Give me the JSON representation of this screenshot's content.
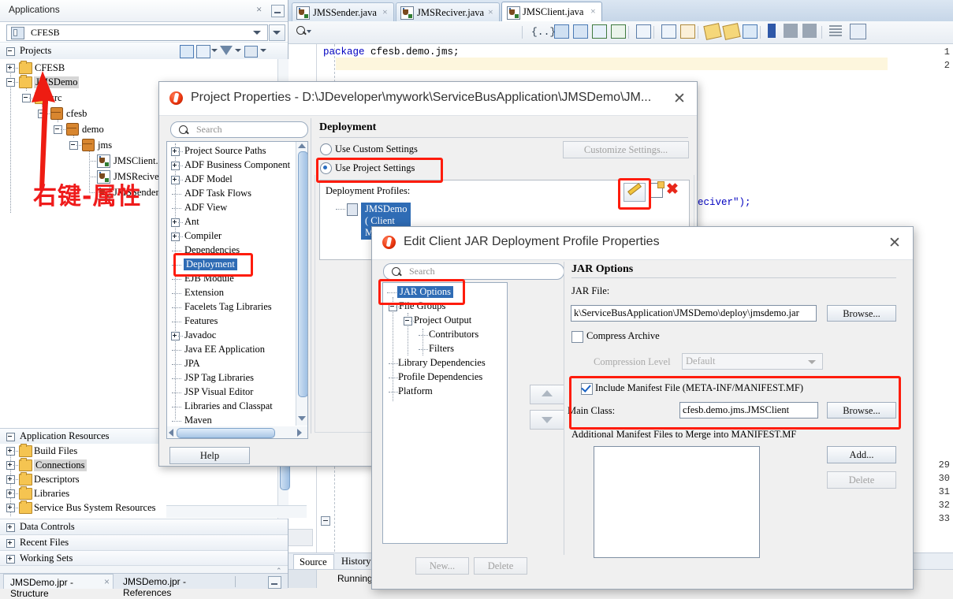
{
  "app": {
    "applications_panel_title": "Applications",
    "application_combo_value": "CFESB",
    "projects_header": "Projects",
    "application_resources_header": "Application Resources",
    "project_tree": [
      {
        "label": "CFESB",
        "type": "folder",
        "indent": 0,
        "expander": "plus",
        "selected": false
      },
      {
        "label": "JMSDemo",
        "type": "folder",
        "indent": 0,
        "expander": "minus",
        "selected": true
      },
      {
        "label": "src",
        "type": "folder",
        "indent": 1,
        "expander": "minus",
        "selected": false
      },
      {
        "label": "cfesb",
        "type": "package",
        "indent": 2,
        "expander": "minus",
        "selected": false
      },
      {
        "label": "demo",
        "type": "package",
        "indent": 3,
        "expander": "minus",
        "selected": false
      },
      {
        "label": "jms",
        "type": "package",
        "indent": 4,
        "expander": "minus",
        "selected": false
      },
      {
        "label": "JMSClient.",
        "type": "java",
        "indent": 5,
        "expander": "none",
        "selected": false
      },
      {
        "label": "JMSReciver.",
        "type": "java",
        "indent": 5,
        "expander": "none",
        "selected": false
      },
      {
        "label": "JMSSender.",
        "type": "java",
        "indent": 5,
        "expander": "none",
        "selected": false
      }
    ],
    "annotation_text": "右键-属性",
    "annotation_color": "#ef1b1b",
    "app_resources_tree": [
      {
        "label": "Build Files",
        "selected": false
      },
      {
        "label": "Connections",
        "selected": true
      },
      {
        "label": "Descriptors",
        "selected": false
      },
      {
        "label": "Libraries",
        "selected": false
      },
      {
        "label": "Service Bus System Resources",
        "selected": false
      }
    ],
    "collapsed_sections": [
      "Data Controls",
      "Recent Files",
      "Working Sets"
    ],
    "bottom_tabs": [
      {
        "label": "JMSDemo.jpr - Structure",
        "active": true,
        "closable": true
      },
      {
        "label": "JMSDemo.jpr - References",
        "active": false,
        "closable": false
      }
    ]
  },
  "editor": {
    "tabs": [
      {
        "label": "JMSSender.java",
        "active": false
      },
      {
        "label": "JMSReciver.java",
        "active": false
      },
      {
        "label": "JMSClient.java",
        "active": true
      }
    ],
    "find_placeholder": "Find",
    "code_lines": [
      {
        "num": "1",
        "text": "package cfesb.demo.jms;"
      },
      {
        "num": "2",
        "text": ""
      }
    ],
    "partial_code_fragment": "eciver\");",
    "lower_line_numbers": [
      "29",
      "30",
      "31",
      "32",
      "33"
    ],
    "source_tabs": [
      {
        "label": "Source",
        "active": true
      },
      {
        "label": "History",
        "active": false
      }
    ],
    "status_text": "Running: JMSDemo.j",
    "toolbar_icons": [
      "braces-icon",
      "debug-step-icon",
      "refactor-icon",
      "export-icon",
      "run-to-icon",
      "outline-icon",
      "properties-icon",
      "highlight-icon",
      "remove-highlight-icon",
      "block-indent-icon",
      "bookmark-icon",
      "bookmark-next-icon",
      "bookmark-prev-icon",
      "align-icon",
      "font-size-icon"
    ]
  },
  "project_properties_dialog": {
    "title": "Project Properties - D:\\JDeveloper\\mywork\\ServiceBusApplication\\JMSDemo\\JM...",
    "search_placeholder": "Search",
    "nav_items": [
      {
        "label": "Project Source Paths",
        "expander": "plus",
        "selected": false
      },
      {
        "label": "ADF Business Component",
        "expander": "plus",
        "selected": false
      },
      {
        "label": "ADF Model",
        "expander": "plus",
        "selected": false
      },
      {
        "label": "ADF Task Flows",
        "expander": "none",
        "selected": false
      },
      {
        "label": "ADF View",
        "expander": "none",
        "selected": false
      },
      {
        "label": "Ant",
        "expander": "plus",
        "selected": false
      },
      {
        "label": "Compiler",
        "expander": "plus",
        "selected": false
      },
      {
        "label": "Dependencies",
        "expander": "none",
        "selected": false
      },
      {
        "label": "Deployment",
        "expander": "none",
        "selected": true
      },
      {
        "label": "EJB Module",
        "expander": "none",
        "selected": false
      },
      {
        "label": "Extension",
        "expander": "none",
        "selected": false
      },
      {
        "label": "Facelets Tag Libraries",
        "expander": "none",
        "selected": false
      },
      {
        "label": "Features",
        "expander": "none",
        "selected": false
      },
      {
        "label": "Javadoc",
        "expander": "plus",
        "selected": false
      },
      {
        "label": "Java EE Application",
        "expander": "none",
        "selected": false
      },
      {
        "label": "JPA",
        "expander": "none",
        "selected": false
      },
      {
        "label": "JSP Tag Libraries",
        "expander": "none",
        "selected": false
      },
      {
        "label": "JSP Visual Editor",
        "expander": "none",
        "selected": false
      },
      {
        "label": "Libraries and Classpat",
        "expander": "none",
        "selected": false
      },
      {
        "label": "Maven",
        "expander": "none",
        "selected": false
      }
    ],
    "section_title": "Deployment",
    "radio_custom_label": "Use Custom Settings",
    "radio_project_label": "Use Project Settings",
    "radio_selected": "project",
    "customize_button": "Customize Settings...",
    "deployment_profiles_label": "Deployment Profiles:",
    "profile_item": "JMSDemo ( Client Module )",
    "help_button": "Help"
  },
  "edit_jar_dialog": {
    "title": "Edit Client JAR Deployment Profile Properties",
    "search_placeholder": "Search",
    "nav_items": [
      {
        "label": "JAR Options",
        "indent": 0,
        "expander": "none",
        "selected": true
      },
      {
        "label": "File Groups",
        "indent": 0,
        "expander": "minus",
        "selected": false
      },
      {
        "label": "Project Output",
        "indent": 1,
        "expander": "minus",
        "selected": false
      },
      {
        "label": "Contributors",
        "indent": 2,
        "expander": "none",
        "selected": false
      },
      {
        "label": "Filters",
        "indent": 2,
        "expander": "none",
        "selected": false
      },
      {
        "label": "Library Dependencies",
        "indent": 0,
        "expander": "none",
        "selected": false
      },
      {
        "label": "Profile Dependencies",
        "indent": 0,
        "expander": "none",
        "selected": false
      },
      {
        "label": "Platform",
        "indent": 0,
        "expander": "none",
        "selected": false
      }
    ],
    "section_title": "JAR Options",
    "jar_file_label": "JAR File:",
    "jar_file_value": "k\\ServiceBusApplication\\JMSDemo\\deploy\\jmsdemo.jar",
    "browse_button": "Browse...",
    "compress_archive_label": "Compress Archive",
    "compress_archive_checked": false,
    "compression_level_label": "Compression Level",
    "compression_level_value": "Default",
    "include_manifest_label": "Include Manifest File (META-INF/MANIFEST.MF)",
    "include_manifest_checked": true,
    "main_class_label": "Main Class:",
    "main_class_value": "cfesb.demo.jms.JMSClient",
    "main_class_browse_button": "Browse...",
    "additional_manifest_label": "Additional Manifest Files to Merge into MANIFEST.MF",
    "add_button": "Add...",
    "delete_button": "Delete",
    "new_button": "New...",
    "list_delete_button": "Delete"
  },
  "colors": {
    "annotation_red": "#fe1c0c",
    "selection_blue": "#2f6cb5",
    "keyword_blue": "#0000c0"
  }
}
